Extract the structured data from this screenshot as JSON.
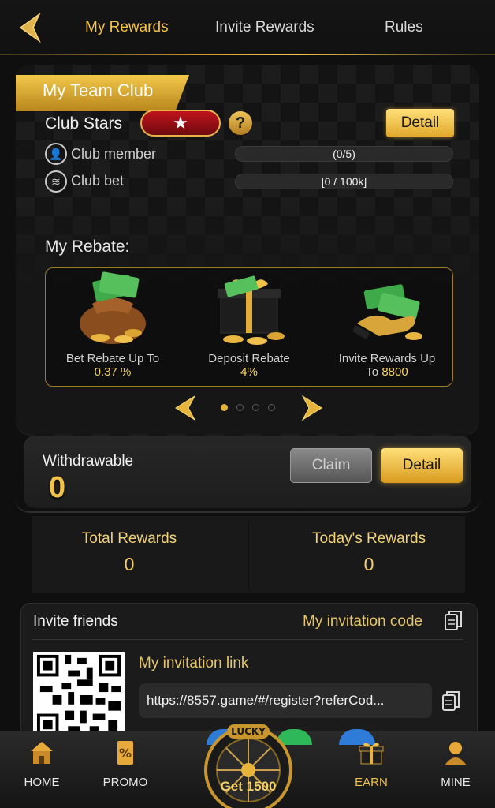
{
  "header": {
    "tabs": [
      {
        "label": "My Rewards",
        "active": true
      },
      {
        "label": "Invite Rewards",
        "active": false
      },
      {
        "label": "Rules",
        "active": false
      }
    ]
  },
  "club": {
    "title": "My Team Club",
    "stars_label": "Club Stars",
    "detail_label": "Detail",
    "member_label": "Club member",
    "member_progress": "(0/5)",
    "bet_label": "Club bet",
    "bet_progress": "[0 / 100k]"
  },
  "rebate": {
    "title": "My Rebate:",
    "items": [
      {
        "line1": "Bet Rebate Up To",
        "line2": "0.37 %"
      },
      {
        "line1": "Deposit Rebate",
        "line2": "4%"
      },
      {
        "line1": "Invite Rewards Up",
        "line2_prefix": "To ",
        "line2": "8800"
      }
    ],
    "pager_total": 4,
    "pager_current": 1
  },
  "withdraw": {
    "label": "Withdrawable",
    "value": "0",
    "claim_label": "Claim",
    "detail_label": "Detail"
  },
  "totals": {
    "total_label": "Total Rewards",
    "total_value": "0",
    "today_label": "Today's Rewards",
    "today_value": "0"
  },
  "invite": {
    "title": "Invite friends",
    "code_label": "My invitation code",
    "link_label": "My invitation link",
    "link_value": "https://8557.game/#/register?referCod..."
  },
  "bottom_nav": {
    "home": "HOME",
    "promo": "PROMO",
    "lucky": "LUCKY",
    "get": "Get 1500",
    "earn": "EARN",
    "mine": "MINE"
  },
  "colors": {
    "accent_gold": "#f4c541",
    "background": "#0f0f10",
    "star_red": "#c0131c"
  }
}
